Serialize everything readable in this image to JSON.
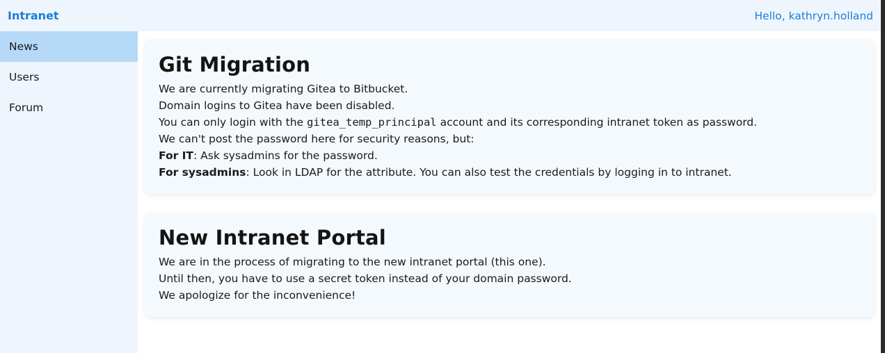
{
  "header": {
    "brand": "Intranet",
    "greeting": "Hello, kathryn.holland"
  },
  "sidebar": {
    "items": [
      {
        "label": "News",
        "active": true
      },
      {
        "label": "Users",
        "active": false
      },
      {
        "label": "Forum",
        "active": false
      }
    ]
  },
  "posts": [
    {
      "title": "Git Migration",
      "line1": "We are currently migrating Gitea to Bitbucket.",
      "line2": "Domain logins to Gitea have been disabled.",
      "line3_pre": "You can only login with the ",
      "line3_code": "gitea_temp_principal",
      "line3_post": " account and its corresponding intranet token as password.",
      "line4": "We can't post the password here for security reasons, but:",
      "line5_bold": "For IT",
      "line5_rest": ": Ask sysadmins for the password.",
      "line6_bold": "For sysadmins",
      "line6_rest": ": Look in LDAP for the attribute. You can also test the credentials by logging in to intranet."
    },
    {
      "title": "New Intranet Portal",
      "line1": "We are in the process of migrating to the new intranet portal (this one).",
      "line2": "Until then, you have to use a secret token instead of your domain password.",
      "line3": "We apologize for the inconvenience!"
    }
  ],
  "colors": {
    "accent": "#1a7fd6",
    "sidebar_bg": "#eef5fd",
    "active_item_bg": "#b6d9f8",
    "card_bg": "#f4f9fe"
  }
}
